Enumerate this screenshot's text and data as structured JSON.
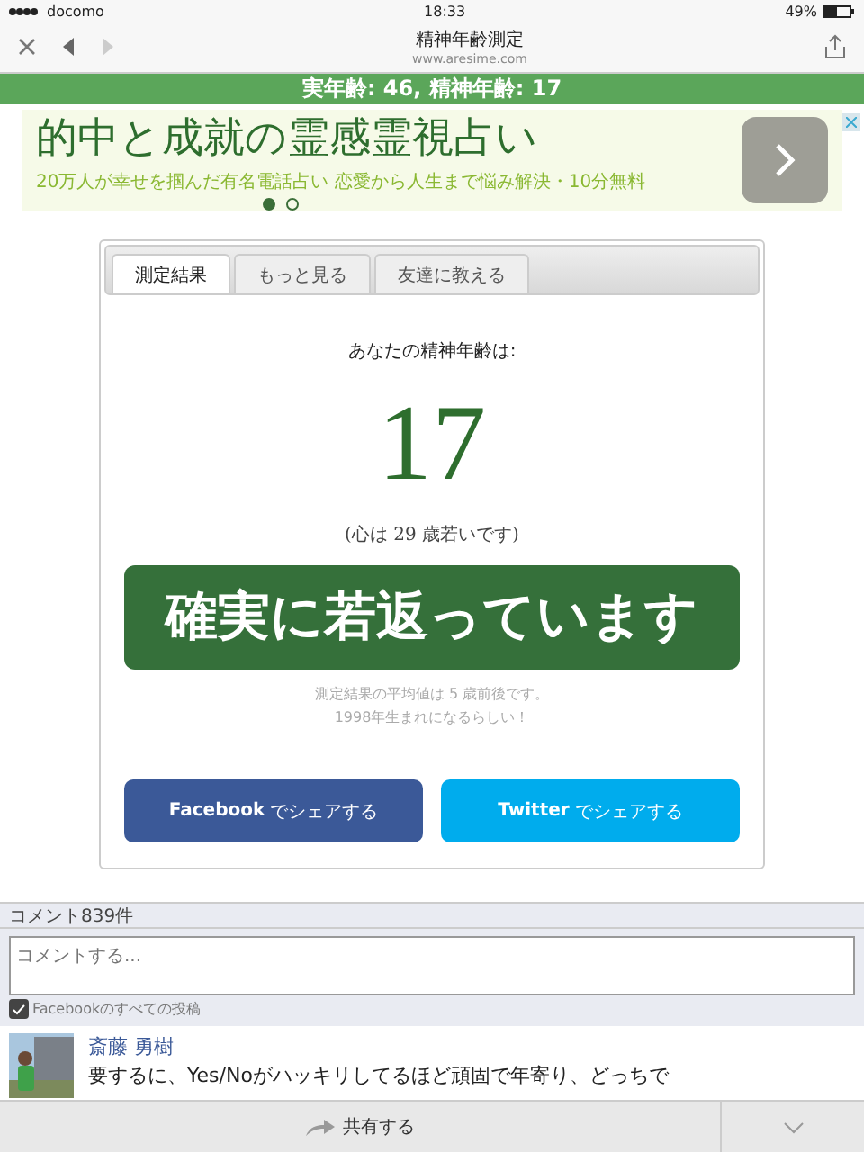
{
  "status_bar": {
    "carrier": "docomo",
    "time": "18:33",
    "battery": "49%"
  },
  "browser": {
    "title": "精神年齢測定",
    "url": "www.aresime.com"
  },
  "headline": "実年齢: 46, 精神年齢: 17",
  "ad": {
    "title": "的中と成就の霊感霊視占い",
    "text": "20万人が幸せを掴んだ有名電話占い 恋愛から人生まで悩み解決・10分無料",
    "pages": [
      {
        "selected": true
      },
      {
        "selected": false
      }
    ]
  },
  "tabs": [
    {
      "label": "測定結果",
      "selected": true
    },
    {
      "label": "もっと見る",
      "selected": false
    },
    {
      "label": "友達に教える",
      "selected": false
    }
  ],
  "result": {
    "intro": "あなたの精神年齢は:",
    "age": "17",
    "diff": "(心は 29 歳若いです)",
    "verdict": "確実に若返っています",
    "note_lines": [
      "測定結果の平均値は 5 歳前後です。",
      "1998年生まれになるらしい！"
    ]
  },
  "share_buttons": [
    {
      "kind": "facebook",
      "brand": "Facebook",
      "label": "でシェアする"
    },
    {
      "kind": "twitter",
      "brand": "Twitter",
      "label": "でシェアする"
    }
  ],
  "comments": {
    "count": "コメント839件",
    "placeholder": "コメントする...",
    "post_to_facebook": {
      "label": "Facebookのすべての投稿",
      "checked": true
    },
    "items": [
      {
        "author": "斎藤 勇樹",
        "text": "要するに、Yes/Noがハッキリしてるほど頑固で年寄り、どっちで"
      }
    ]
  },
  "bottom_bar": {
    "share": "共有する"
  }
}
